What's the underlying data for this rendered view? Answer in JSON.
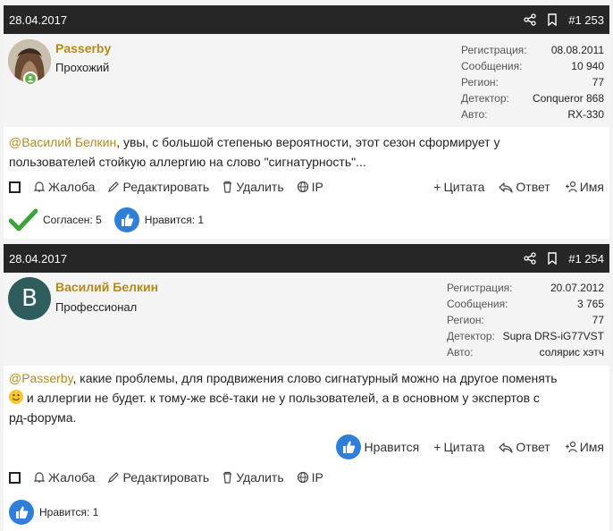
{
  "posts": [
    {
      "date": "28.04.2017",
      "post_number": "#1 253",
      "author": {
        "name": "Passerby",
        "title": "Прохожий"
      },
      "stats": [
        {
          "label": "Регистрация:",
          "value": "08.08.2011"
        },
        {
          "label": "Сообщения:",
          "value": "10 940"
        },
        {
          "label": "Регион:",
          "value": "77"
        },
        {
          "label": "Детектор:",
          "value": "Conqueror 868"
        },
        {
          "label": "Авто:",
          "value": "RX-330"
        }
      ],
      "body": {
        "mention": "@Василий Белкин",
        "line1": ", увы, с большой степенью вероятности, этот сезон сформирует у",
        "line2": "пользователей стойкую аллергию на слово \"сигнатурность\"..."
      },
      "actions": {
        "report": "Жалоба",
        "edit": "Редактировать",
        "delete": "Удалить",
        "ip": "IP",
        "quote": "Цитата",
        "reply": "Ответ",
        "name": "Имя"
      },
      "reactions": {
        "agree": "Согласен: 5",
        "like": "Нравится: 1"
      }
    },
    {
      "date": "28.04.2017",
      "post_number": "#1 254",
      "author": {
        "name": "Василий Белкин",
        "title": "Профессионал",
        "avatar_letter": "B"
      },
      "stats": [
        {
          "label": "Регистрация:",
          "value": "20.07.2012"
        },
        {
          "label": "Сообщения:",
          "value": "3 765"
        },
        {
          "label": "Регион:",
          "value": "77"
        },
        {
          "label": "Детектор:",
          "value": "Supra DRS-iG77VST"
        },
        {
          "label": "Авто:",
          "value": "солярис хэтч"
        }
      ],
      "body": {
        "mention": "@Passerby",
        "line1": ", какие проблемы, для продвижения слово сигнатурный можно на другое поменять",
        "line2": " и аллергии не будет. к тому-же всё-таки не у пользователей, а в основном у экспертов с",
        "line3": "рд-форума."
      },
      "top_actions": {
        "like": "Нравится",
        "quote": "Цитата",
        "reply": "Ответ",
        "name": "Имя"
      },
      "actions": {
        "report": "Жалоба",
        "edit": "Редактировать",
        "delete": "Удалить",
        "ip": "IP"
      },
      "reactions": {
        "like": "Нравится: 1"
      }
    }
  ],
  "colors": {
    "header": "#262626",
    "username": "#b58a1a",
    "like": "#2f7fd8",
    "agree": "#3aa534",
    "online": "#63b44a",
    "avatar_b": "#2f5d5d"
  }
}
